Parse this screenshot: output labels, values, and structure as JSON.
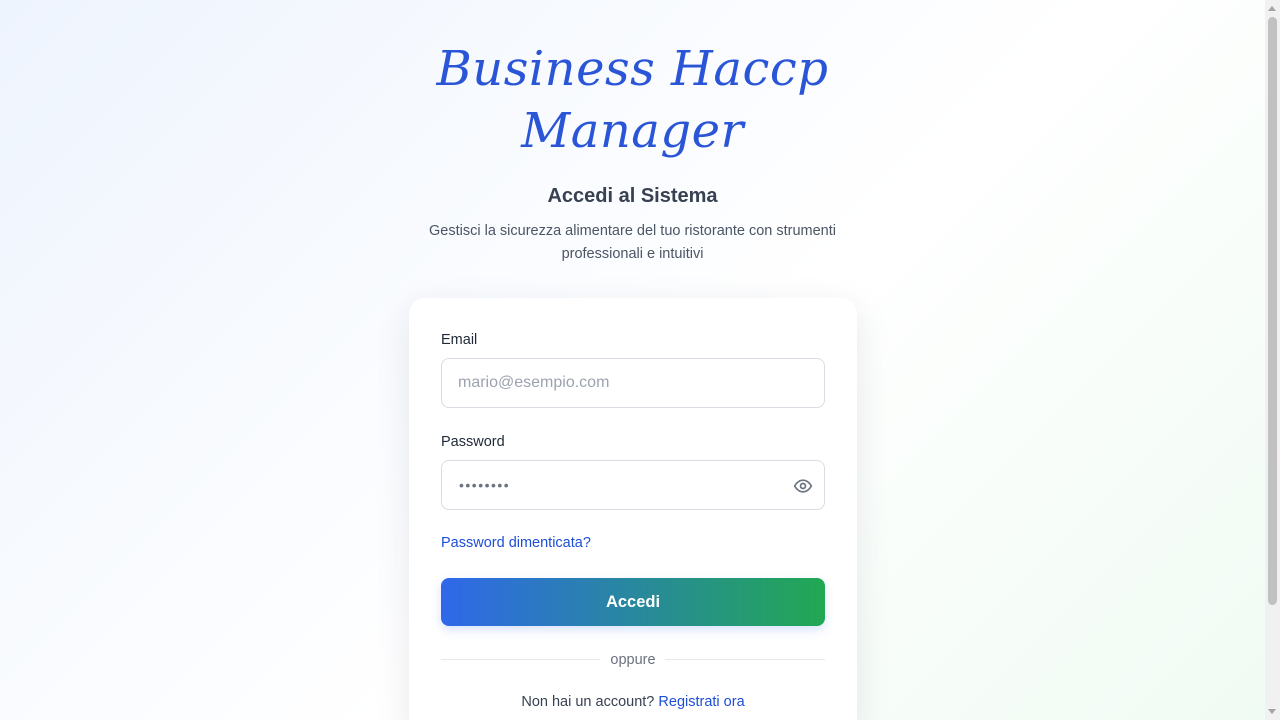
{
  "brand": {
    "line1": "Business Haccp",
    "line2": "Manager"
  },
  "header": {
    "title": "Accedi al Sistema",
    "tagline": "Gestisci la sicurezza alimentare del tuo ristorante con strumenti professionali e intuitivi"
  },
  "form": {
    "email_label": "Email",
    "email_placeholder": "mario@esempio.com",
    "password_label": "Password",
    "password_masked": "••••••••",
    "toggle_icon": "eye-icon",
    "forgot_label": "Password dimenticata?",
    "submit_label": "Accedi",
    "divider_label": "oppure",
    "signup_prompt": "Non hai un account?",
    "signup_link": "Registrati ora"
  },
  "colors": {
    "brand": "#2a55d6",
    "link": "#1d4ed8",
    "button_gradient_start": "#2f68ea",
    "button_gradient_end": "#22a852"
  }
}
